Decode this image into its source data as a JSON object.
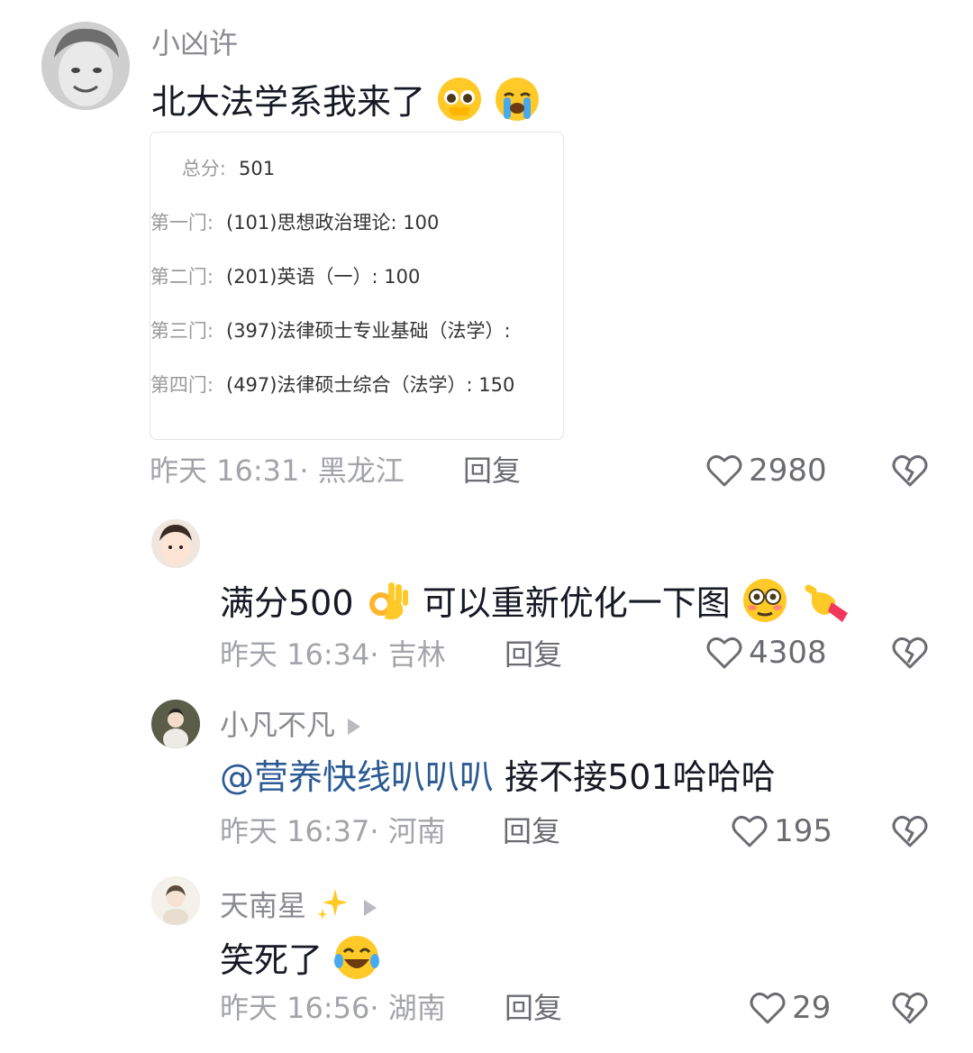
{
  "comments": [
    {
      "user": "小凶许",
      "text": "北大法学系我来了",
      "emojis": [
        "pleading-face-icon",
        "crying-face-icon"
      ],
      "scores": [
        {
          "label": "总分:",
          "value": "501"
        },
        {
          "label": "第一门:",
          "value": "(101)思想政治理论: 100"
        },
        {
          "label": "第二门:",
          "value": "(201)英语（一）: 100"
        },
        {
          "label": "第三门:",
          "value": "(397)法律硕士专业基础（法学）:"
        },
        {
          "label": "第四门:",
          "value": "(497)法律硕士综合（法学）: 150"
        }
      ],
      "time_location": "昨天 16:31· 黑龙江",
      "reply_label": "回复",
      "likes": "2980"
    },
    {
      "user": "",
      "text": "满分500",
      "text2": "可以重新优化一下图",
      "time_location": "昨天 16:34· 吉林",
      "reply_label": "回复",
      "likes": "4308"
    },
    {
      "user": "小凡不凡",
      "mention": "@营养快线叭叭叭",
      "text": " 接不接501哈哈哈",
      "time_location": "昨天 16:37· 河南",
      "reply_label": "回复",
      "likes": "195"
    },
    {
      "user": "天南星",
      "text": "笑死了",
      "time_location": "昨天 16:56· 湖南",
      "reply_label": "回复",
      "likes": "29"
    }
  ],
  "colors": {
    "text": "#161823",
    "username": "#8a8b91",
    "meta": "#a3a4a9",
    "mention": "#2b5a93"
  }
}
